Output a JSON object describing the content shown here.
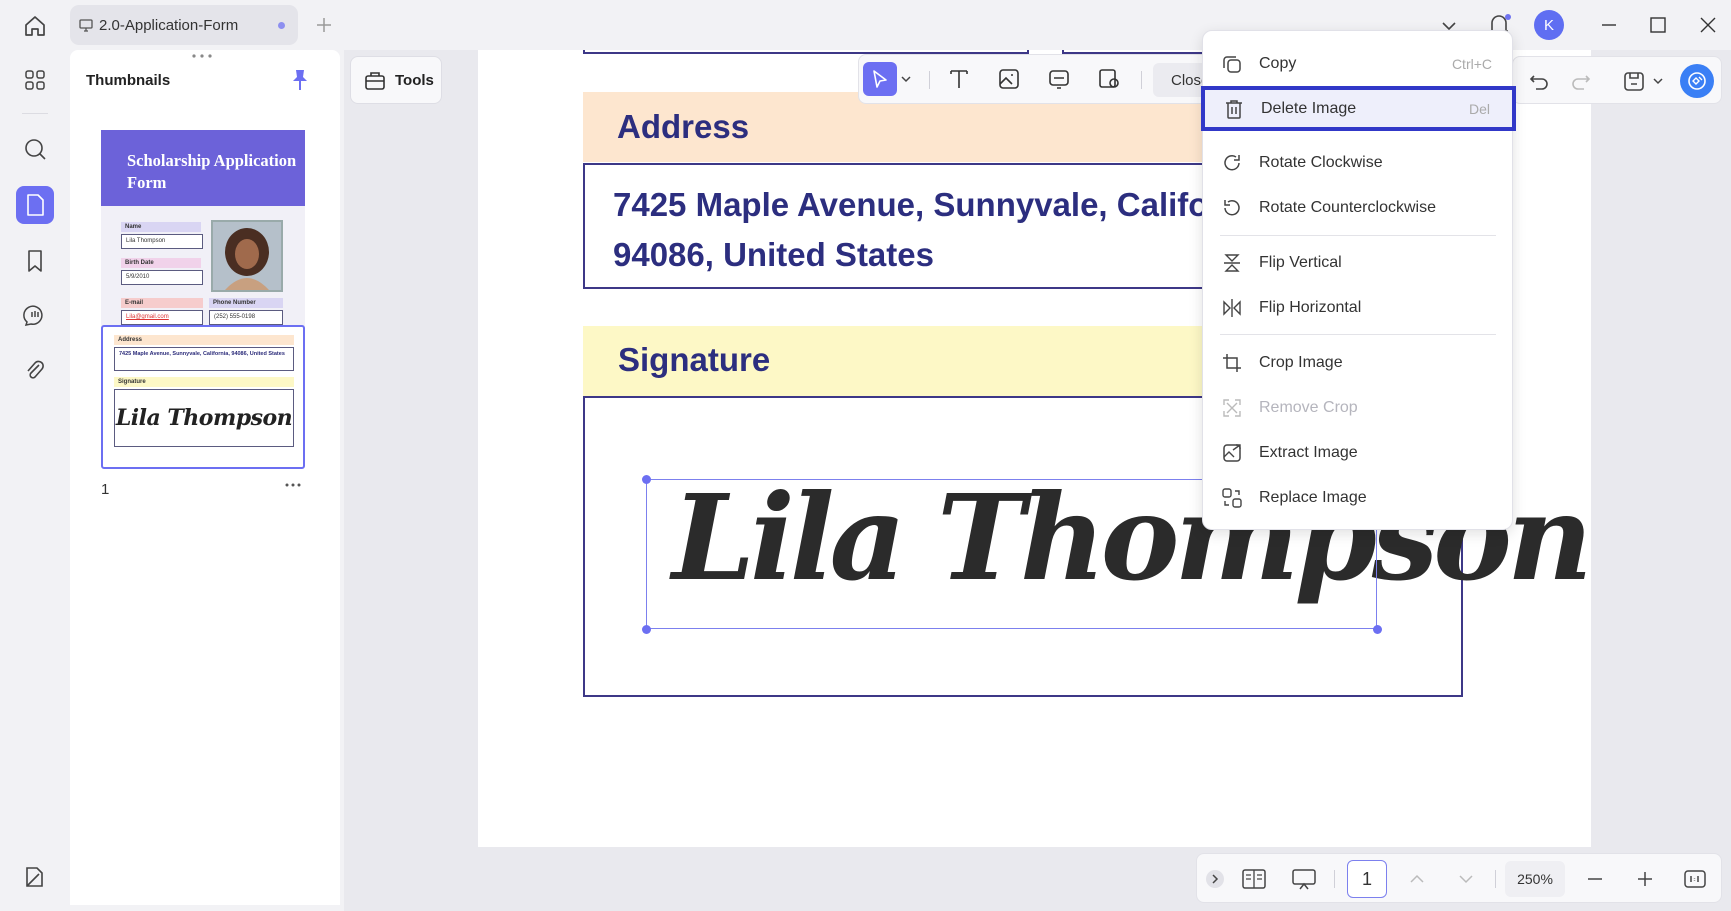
{
  "titlebar": {
    "tab_title": "2.0-Application-Form",
    "avatar_initial": "K"
  },
  "thumbnails": {
    "title": "Thumbnails",
    "page_number": "1",
    "form_title": "Scholarship Application Form",
    "fields": [
      {
        "label": "Name",
        "value": "Lila Thompson"
      },
      {
        "label": "Birth Date",
        "value": "5/9/2010"
      },
      {
        "label": "E-mail",
        "value": "Lila@gmail.com"
      },
      {
        "label": "Phone Number",
        "value": "(252) 555-0198"
      }
    ],
    "address_label": "Address",
    "address_value": "7425 Maple Avenue, Sunnyvale, California, 94086, United States",
    "signature_label": "Signature",
    "signature_value": "Lila Thompson"
  },
  "toolbar": {
    "tools_label": "Tools",
    "close_label": "Close"
  },
  "document": {
    "address_label": "Address",
    "address_line1": "7425 Maple Avenue, Sunnyvale, Califo",
    "address_line2": "94086, United States",
    "signature_label": "Signature",
    "signature_text": "Lila Thompson"
  },
  "context_menu": {
    "items": [
      {
        "label": "Copy",
        "shortcut": "Ctrl+C",
        "icon": "copy-icon"
      },
      {
        "label": "Delete Image",
        "shortcut": "Del",
        "icon": "trash-icon"
      },
      {
        "label": "Rotate Clockwise",
        "icon": "rotate-cw-icon"
      },
      {
        "label": "Rotate Counterclockwise",
        "icon": "rotate-ccw-icon"
      },
      {
        "label": "Flip Vertical",
        "icon": "flip-vertical-icon"
      },
      {
        "label": "Flip Horizontal",
        "icon": "flip-horizontal-icon"
      },
      {
        "label": "Crop Image",
        "icon": "crop-icon"
      },
      {
        "label": "Remove Crop",
        "icon": "remove-crop-icon"
      },
      {
        "label": "Extract Image",
        "icon": "extract-image-icon"
      },
      {
        "label": "Replace Image",
        "icon": "replace-image-icon"
      }
    ]
  },
  "bottom_bar": {
    "page_value": "1",
    "zoom": "250%"
  },
  "colors": {
    "accent": "#6c6ff2",
    "highlight_border": "#3138c8",
    "heading_text": "#2c2e7f",
    "address_band": "#fde6cf",
    "signature_band": "#fdf8c6"
  }
}
